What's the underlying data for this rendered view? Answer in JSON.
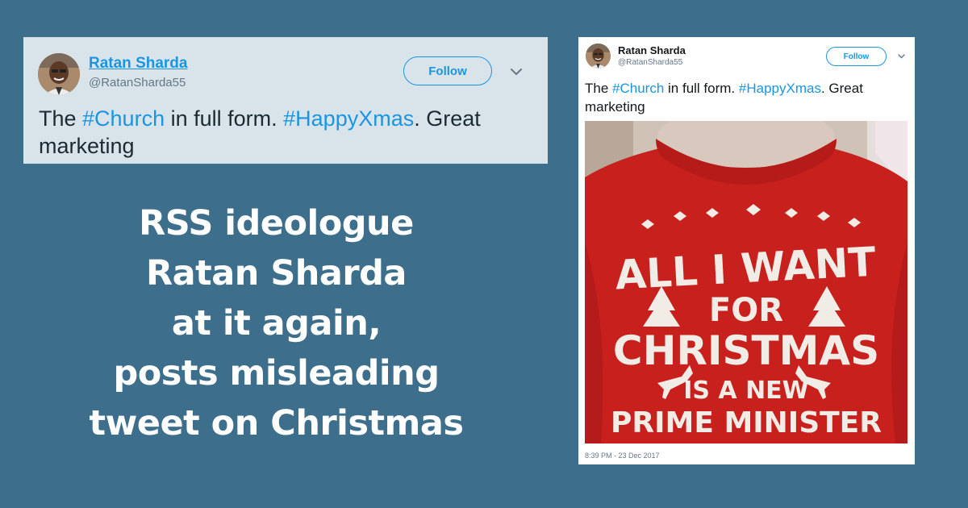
{
  "tweet": {
    "name": "Ratan Sharda",
    "handle": "@RatanSharda55",
    "follow_label": "Follow",
    "text_parts": {
      "p1": "The ",
      "tag1": "#Church",
      "p2": " in full form. ",
      "tag2": "#HappyXmas",
      "p3": ". Great marketing"
    },
    "timestamp": "8:39 PM - 23 Dec 2017",
    "icons": {
      "avatar": "user-avatar",
      "menu": "chevron-down-icon"
    }
  },
  "headline": {
    "lines": [
      "RSS ideologue",
      "Ratan Sharda",
      "at it again,",
      "posts misleading",
      "tweet on Christmas"
    ]
  },
  "photo": {
    "lines": [
      "ALL I WANT",
      "FOR",
      "CHRISTMAS",
      "IS A NEW",
      "PRIME MINISTER"
    ]
  },
  "colors": {
    "background": "#3d6e8c",
    "link": "#1b95e0",
    "sweater": "#c8201d",
    "print": "#f1ece6"
  }
}
